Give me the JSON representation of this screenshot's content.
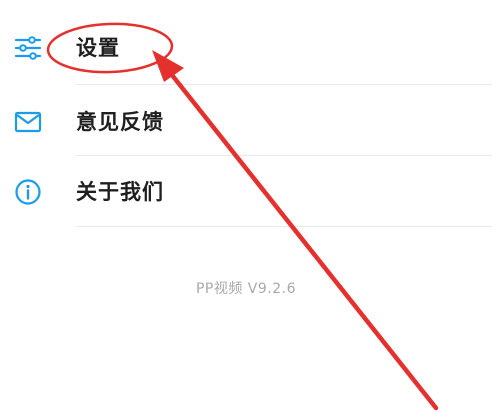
{
  "menu": {
    "items": [
      {
        "label": "设置",
        "icon": "sliders-icon"
      },
      {
        "label": "意见反馈",
        "icon": "mail-icon"
      },
      {
        "label": "关于我们",
        "icon": "info-icon"
      }
    ]
  },
  "footer": {
    "version": "PP视频 V9.2.6"
  },
  "colors": {
    "accent_icon": "#1a9ce6",
    "annotation_red": "#e5312d",
    "label_text": "#1f1f1f",
    "version_text": "#a8a8a8"
  }
}
